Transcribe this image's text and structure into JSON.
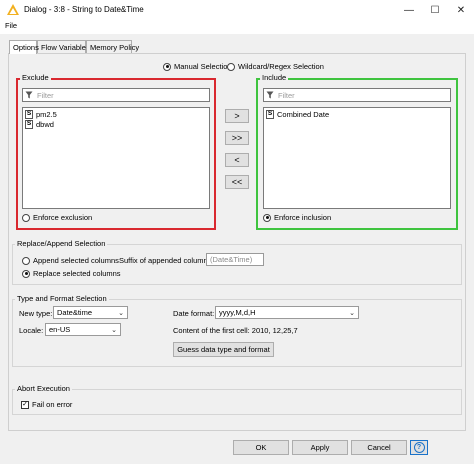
{
  "window": {
    "title": "Dialog - 3:8 - String to Date&Time",
    "minimize_glyph": "—",
    "maximize_glyph": "☐",
    "close_glyph": "✕"
  },
  "menu": {
    "file": "File"
  },
  "tabs": [
    {
      "label": "Options",
      "active": true
    },
    {
      "label": "Flow Variables",
      "active": false
    },
    {
      "label": "Memory Policy",
      "active": false
    }
  ],
  "column_filter": {
    "mode_manual": "Manual Selection",
    "mode_wildcard": "Wildcard/Regex Selection",
    "selected_mode": "manual",
    "exclude": {
      "title": "Exclude",
      "filter_placeholder": "Filter",
      "items": [
        {
          "type": "S",
          "name": "pm2.5"
        },
        {
          "type": "S",
          "name": "dbwd"
        }
      ],
      "enforce_label": "Enforce exclusion",
      "enforce_selected": false,
      "border_color": "#d9282f"
    },
    "include": {
      "title": "Include",
      "filter_placeholder": "Filter",
      "items": [
        {
          "type": "S",
          "name": "Combined Date"
        }
      ],
      "enforce_label": "Enforce inclusion",
      "enforce_selected": true,
      "border_color": "#3fc43f"
    },
    "move_buttons": [
      ">",
      ">>",
      "<",
      "<<"
    ]
  },
  "replace_append": {
    "title": "Replace/Append Selection",
    "append_label": "Append selected columns",
    "replace_label": "Replace selected columns",
    "selected": "replace",
    "suffix_label": "Suffix of appended columns:",
    "suffix_value": "(Date&Time)"
  },
  "type_format": {
    "title": "Type and Format Selection",
    "new_type_label": "New type:",
    "new_type_value": "Date&time",
    "date_format_label": "Date format:",
    "date_format_value": "yyyy,M,d,H",
    "locale_label": "Locale:",
    "locale_value": "en-US",
    "first_cell_label": "Content of the first cell: 2010, 12,25,7",
    "guess_button": "Guess data type and format"
  },
  "abort": {
    "title": "Abort Execution",
    "fail_label": "Fail on error",
    "fail_checked": true
  },
  "buttons": {
    "ok": "OK",
    "apply": "Apply",
    "cancel": "Cancel",
    "help": "?"
  },
  "colors": {
    "accent_knime": "#f2b01e",
    "help_button": "#1a72c9"
  }
}
